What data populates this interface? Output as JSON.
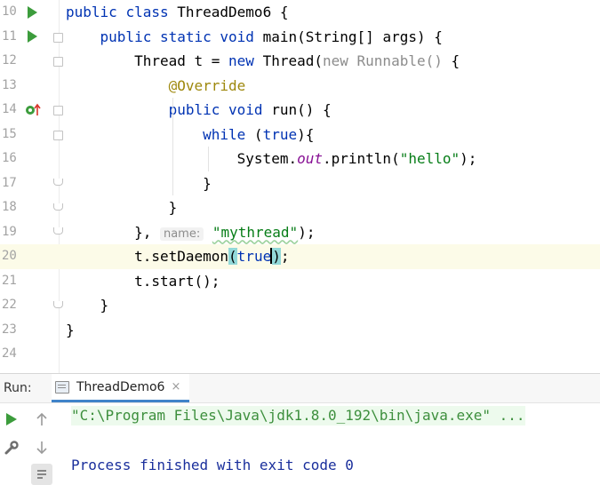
{
  "editor": {
    "lines": [
      {
        "num": "10",
        "segs": [
          [
            "kw",
            "public "
          ],
          [
            "kw",
            "class "
          ],
          [
            "t",
            "ThreadDemo6 {"
          ]
        ]
      },
      {
        "num": "11",
        "segs": [
          [
            "t",
            "    "
          ],
          [
            "kw",
            "public "
          ],
          [
            "kw",
            "static "
          ],
          [
            "kw",
            "void "
          ],
          [
            "t",
            "main(String[] args) {"
          ]
        ]
      },
      {
        "num": "12",
        "segs": [
          [
            "t",
            "        Thread t = "
          ],
          [
            "kw",
            "new "
          ],
          [
            "t",
            "Thread("
          ],
          [
            "gray",
            "new "
          ],
          [
            "gray",
            "Runnable() "
          ],
          [
            "t",
            "{"
          ]
        ]
      },
      {
        "num": "13",
        "segs": [
          [
            "t",
            "            "
          ],
          [
            "ann",
            "@Override"
          ]
        ]
      },
      {
        "num": "14",
        "segs": [
          [
            "t",
            "            "
          ],
          [
            "kw",
            "public "
          ],
          [
            "kw",
            "void "
          ],
          [
            "t",
            "run() {"
          ]
        ]
      },
      {
        "num": "15",
        "segs": [
          [
            "t",
            "                "
          ],
          [
            "kw",
            "while "
          ],
          [
            "t",
            "("
          ],
          [
            "kw",
            "true"
          ],
          [
            "t",
            ")"
          ],
          [
            "t",
            "{"
          ]
        ]
      },
      {
        "num": "16",
        "segs": [
          [
            "t",
            "                    System."
          ],
          [
            "fld",
            "out"
          ],
          [
            "t",
            ".println("
          ],
          [
            "str",
            "\"hello\""
          ],
          [
            "t",
            ");"
          ]
        ]
      },
      {
        "num": "17",
        "segs": [
          [
            "t",
            "                }"
          ]
        ]
      },
      {
        "num": "18",
        "segs": [
          [
            "t",
            "            }"
          ]
        ]
      },
      {
        "num": "19",
        "segs": [
          [
            "t",
            "        }, "
          ],
          [
            "hint",
            "name:"
          ],
          [
            "t",
            " "
          ],
          [
            "strsq",
            "\"mythread\""
          ],
          [
            "t",
            ");"
          ]
        ]
      },
      {
        "num": "20",
        "segs": [
          [
            "t",
            "        t.setDaemon"
          ],
          [
            "bhl",
            "("
          ],
          [
            "kw",
            "true"
          ],
          [
            "caret",
            ""
          ],
          [
            "bhl",
            ")"
          ],
          [
            "t",
            ";"
          ]
        ]
      },
      {
        "num": "21",
        "segs": [
          [
            "t",
            "        t.start();"
          ]
        ]
      },
      {
        "num": "22",
        "segs": [
          [
            "t",
            "    }"
          ]
        ]
      },
      {
        "num": "23",
        "segs": [
          [
            "t",
            "}"
          ]
        ]
      },
      {
        "num": "24",
        "segs": []
      }
    ],
    "current_line": "20"
  },
  "run_panel": {
    "label": "Run:",
    "tab_title": "ThreadDemo6",
    "tab_close": "×",
    "command": "\"C:\\Program Files\\Java\\jdk1.8.0_192\\bin\\java.exe\" ...",
    "exit_message": "Process finished with exit code 0"
  },
  "icons": {
    "run_gutter": "run-triangle-icon",
    "implements": "implements-method-icon",
    "rerun": "rerun-icon",
    "scroll_up": "up-arrow-icon",
    "settings": "wrench-icon",
    "scroll_down": "down-arrow-icon",
    "soft_wrap": "soft-wrap-icon"
  },
  "colors": {
    "keyword": "#0033b3",
    "string": "#067d17",
    "annotation": "#9e880d",
    "static_field": "#871094",
    "run_green": "#3c9c3c",
    "brace_match": "#93d9d9"
  }
}
